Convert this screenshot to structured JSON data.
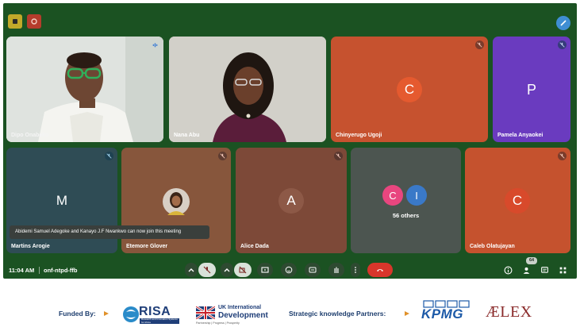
{
  "meeting": {
    "time": "11:04 AM",
    "code": "onf-ntpd-ffb",
    "people_count": "64",
    "notification": "Abidemi Samuel Adegoke and Kanayo J.F Nwankwo can now join this meeting"
  },
  "participants": {
    "p1": {
      "name": "Dipo Onabeko"
    },
    "p2": {
      "name": "Nana Abu"
    },
    "p3": {
      "name": "Chinyerugo Ugoji",
      "initial": "C",
      "color": "#e0552c"
    },
    "p4": {
      "name": "Pamela Anyaokei",
      "initial": "P",
      "color": "#6e3fc4"
    },
    "p5": {
      "name": "Martins Arogie",
      "initial": "M",
      "color": "#2c4a53"
    },
    "p6": {
      "name": "Etemore Glover"
    },
    "p7": {
      "name": "Alice Dada",
      "initial": "A",
      "color": "#7e4a38"
    },
    "p8": {
      "name": "Caleb Olatujayan",
      "initial": "C",
      "color": "#d4482c"
    }
  },
  "others": {
    "label": "56 others",
    "initial1": "C",
    "initial2": "I"
  },
  "icons": [
    "hand-raise-icon",
    "chevron-up-icon",
    "mic-off-icon",
    "camera-off-icon",
    "present-icon",
    "emoji-icon",
    "captions-icon",
    "more-vert-icon",
    "end-call-icon",
    "info-icon",
    "people-icon",
    "chat-icon",
    "apps-icon"
  ],
  "footer": {
    "funded_by": "Funded By:",
    "risa_name": "RISA",
    "risa_sub": "Research and Innovation Systems for Africa",
    "uk_line1": "UK International",
    "uk_line2": "Development",
    "uk_tagline": "Partnership | Progress | Prosperity",
    "partners": "Strategic knowledge Partners:",
    "kpmg": "KPMG",
    "alex": "ÆLEX"
  }
}
